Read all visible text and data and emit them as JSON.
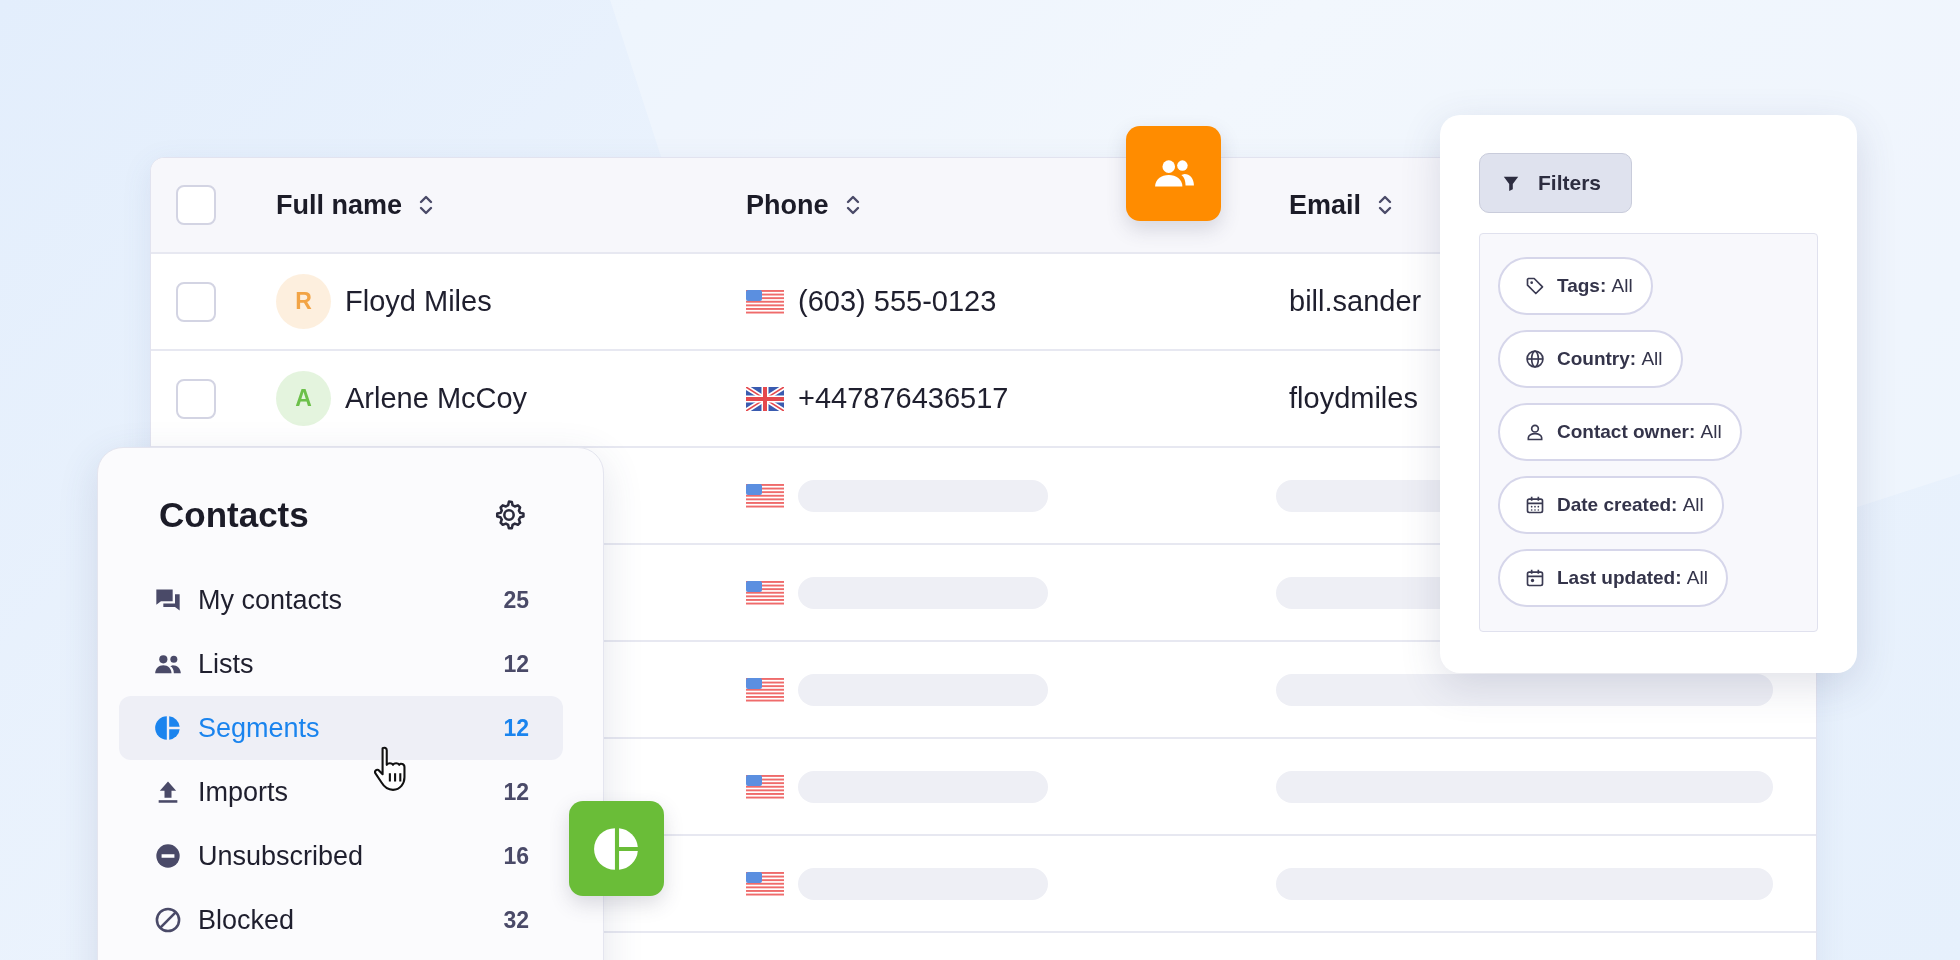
{
  "table": {
    "header_checkbox": {
      "checked": false
    },
    "columns": [
      {
        "label": "Full name"
      },
      {
        "label": "Phone"
      },
      {
        "label": "Email"
      }
    ],
    "rows": [
      {
        "kind": "contact",
        "checked": false,
        "initial": "R",
        "color": "#f2a446",
        "name": "Floyd Miles",
        "flag": {
          "kind": "us"
        },
        "phone": "(603) 555-0123",
        "email": "bill.sander"
      },
      {
        "kind": "contact",
        "checked": false,
        "initial": "A",
        "color": "#6cc04a",
        "name": "Arlene McCoy",
        "flag": {
          "kind": "uk"
        },
        "phone": "+447876436517",
        "email": "floydmiles"
      },
      {
        "kind": "placeholder",
        "flag": {
          "kind": "us"
        }
      },
      {
        "kind": "placeholder",
        "flag": {
          "kind": "us"
        }
      },
      {
        "kind": "placeholder",
        "flag": {
          "kind": "us"
        }
      },
      {
        "kind": "placeholder",
        "flag": {
          "kind": "us"
        }
      },
      {
        "kind": "placeholder",
        "flag": {
          "kind": "us"
        }
      }
    ]
  },
  "sidebar": {
    "title": "Contacts",
    "items": [
      {
        "label": "My contacts",
        "count": "25",
        "selected": false
      },
      {
        "label": "Lists",
        "count": "12",
        "selected": false
      },
      {
        "label": "Segments",
        "count": "12",
        "selected": true
      },
      {
        "label": "Imports",
        "count": "12",
        "selected": false
      },
      {
        "label": "Unsubscribed",
        "count": "16",
        "selected": false
      },
      {
        "label": "Blocked",
        "count": "32",
        "selected": false
      }
    ]
  },
  "filters": {
    "button": "Filters",
    "chips": [
      {
        "label": "Tags:",
        "value": "All"
      },
      {
        "label": "Country:",
        "value": "All"
      },
      {
        "label": "Contact owner:",
        "value": "All"
      },
      {
        "label": "Date created:",
        "value": "All"
      },
      {
        "label": "Last updated:",
        "value": "All"
      }
    ]
  }
}
